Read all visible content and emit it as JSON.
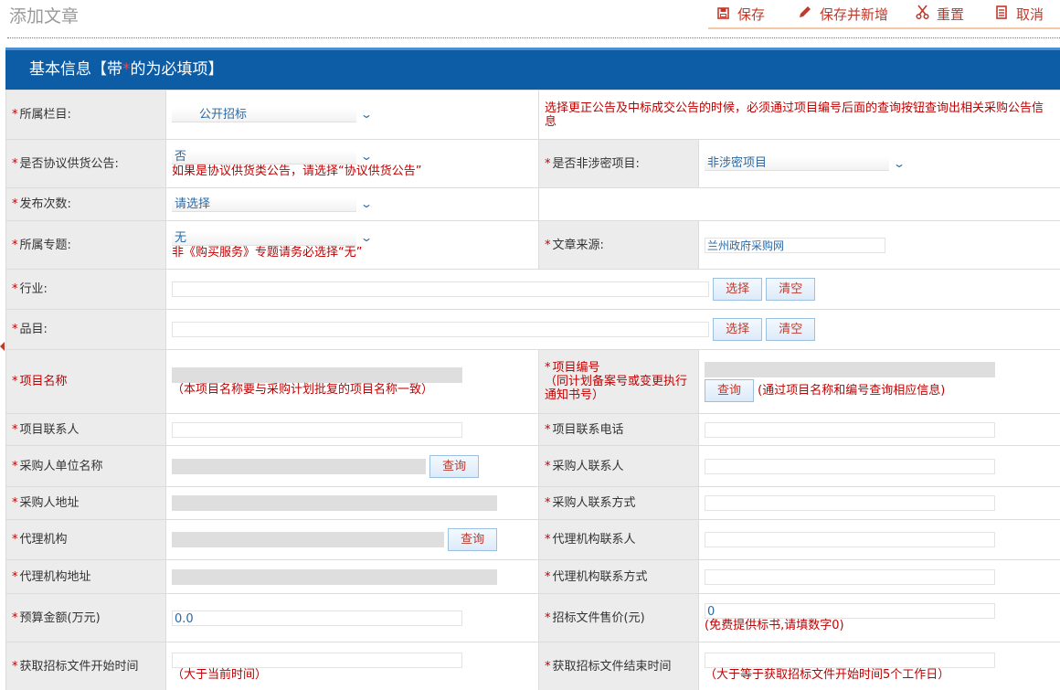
{
  "page": {
    "title": "添加文章"
  },
  "toolbar": {
    "save": "保存",
    "save_new": "保存并新增",
    "reset": "重置",
    "cancel": "取消"
  },
  "section": {
    "title_prefix": "基本信息【带",
    "title_star": "*",
    "title_suffix": "的为必填项】"
  },
  "form": {
    "category": {
      "label": "所属栏目:",
      "value": "公开招标",
      "note": "选择更正公告及中标成交公告的时候，必须通过项目编号后面的查询按钮查询出相关采购公告信息"
    },
    "agreement": {
      "label": "是否协议供货公告:",
      "value": "否",
      "hint": "如果是协议供货类公告，请选择“协议供货公告”"
    },
    "non_secret": {
      "label": "是否非涉密项目:",
      "value": "非涉密项目"
    },
    "publish_count": {
      "label": "发布次数:",
      "value": "请选择"
    },
    "topic": {
      "label": "所属专题:",
      "value": "无",
      "hint": "非《购买服务》专题请务必选择“无”"
    },
    "source": {
      "label": "文章来源:",
      "value": "兰州政府采购网"
    },
    "industry": {
      "label": "行业:",
      "select_btn": "选择",
      "clear_btn": "清空"
    },
    "item": {
      "label": "品目:",
      "select_btn": "选择",
      "clear_btn": "清空"
    },
    "project_name": {
      "label": "项目名称",
      "hint": "（本项目名称要与采购计划批复的项目名称一致）"
    },
    "project_code": {
      "label": "项目编号",
      "label_note": "（同计划备案号或变更执行通知书号）",
      "query_btn": "查询",
      "hint": "(通过项目名称和编号查询相应信息)"
    },
    "project_contact": {
      "label": "项目联系人"
    },
    "project_phone": {
      "label": "项目联系电话"
    },
    "buyer_name": {
      "label": "采购人单位名称",
      "query_btn": "查询"
    },
    "buyer_contact": {
      "label": "采购人联系人"
    },
    "buyer_address": {
      "label": "采购人地址"
    },
    "buyer_contact_way": {
      "label": "采购人联系方式"
    },
    "agency": {
      "label": "代理机构",
      "query_btn": "查询"
    },
    "agency_contact": {
      "label": "代理机构联系人"
    },
    "agency_address": {
      "label": "代理机构地址"
    },
    "agency_contact_way": {
      "label": "代理机构联系方式"
    },
    "budget": {
      "label": "预算金额(万元)",
      "value": "0.0"
    },
    "doc_price": {
      "label": "招标文件售价(元)",
      "value": "0",
      "hint": "(免费提供标书,请填数字0)"
    },
    "doc_start": {
      "label": "获取招标文件开始时间",
      "hint": "（大于当前时间）"
    },
    "doc_end": {
      "label": "获取招标文件结束时间",
      "hint": "（大于等于获取招标文件开始时间5个工作日）"
    }
  }
}
